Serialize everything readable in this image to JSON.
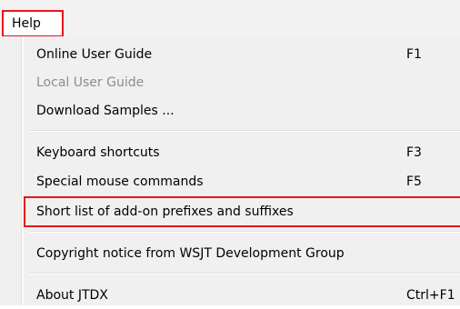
{
  "menu": {
    "title": "Help",
    "items": [
      {
        "label": "Online User Guide",
        "shortcut": "F1",
        "enabled": true
      },
      {
        "label": "Local User Guide",
        "shortcut": "",
        "enabled": false
      },
      {
        "label": "Download Samples ...",
        "shortcut": "",
        "enabled": true
      },
      {
        "label": "Keyboard shortcuts",
        "shortcut": "F3",
        "enabled": true
      },
      {
        "label": "Special mouse commands",
        "shortcut": "F5",
        "enabled": true
      },
      {
        "label": "Short list of add-on prefixes and suffixes",
        "shortcut": "",
        "enabled": true,
        "highlighted": true
      },
      {
        "label": "Copyright notice from WSJT Development Group",
        "shortcut": "",
        "enabled": true
      },
      {
        "label": "About JTDX",
        "shortcut": "Ctrl+F1",
        "enabled": true
      }
    ]
  },
  "colors": {
    "highlight_border": "#e8141c",
    "disabled_text": "#8d8d8d",
    "menu_background": "#f0f0f0"
  }
}
